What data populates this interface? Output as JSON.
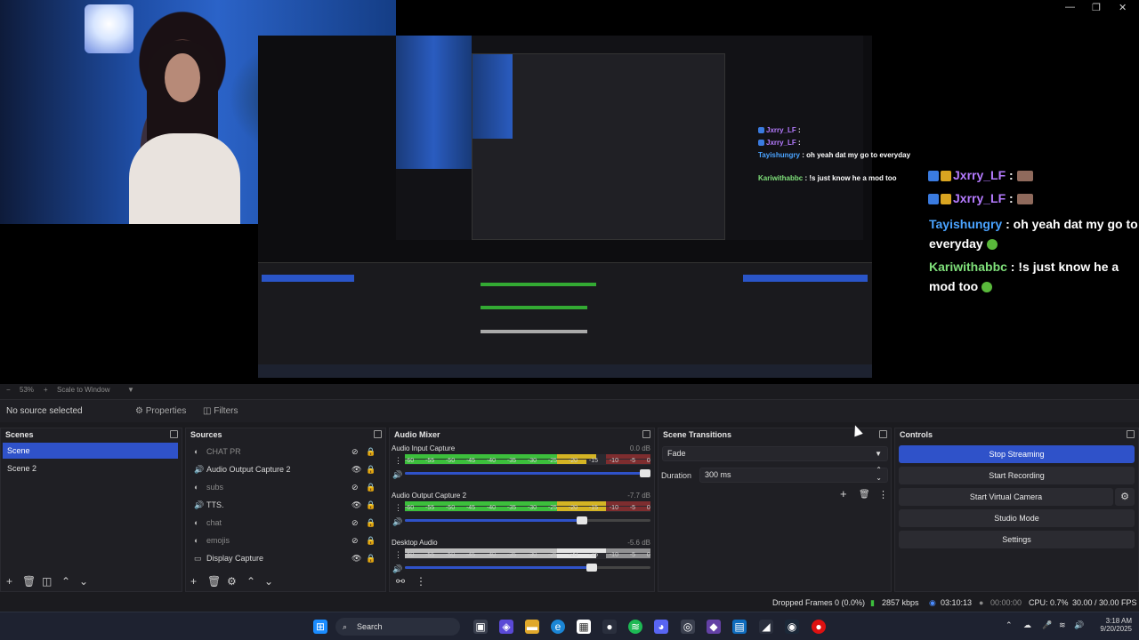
{
  "window_controls": [
    "—",
    "❐",
    "✕"
  ],
  "stream_chat_overlay": [
    {
      "user": "Jxrry_LF",
      "sep": " : ",
      "msg": "",
      "user_color": "#b57bff"
    },
    {
      "user": "Jxrry_LF",
      "sep": " : ",
      "msg": "",
      "user_color": "#b57bff"
    },
    {
      "user": "Tayishungry",
      "sep": " : ",
      "msg": "oh yeah dat my go to everyday",
      "user_color": "#4aa3ff"
    },
    {
      "user": "Kariwithabbc",
      "sep": " : ",
      "msg": "!s just know he a mod too",
      "user_color": "#7fe07a"
    }
  ],
  "zoom_bar": {
    "minus": "−",
    "zoom": "53%",
    "plus": "+",
    "mode": "Scale to Window"
  },
  "toolbar": {
    "no_source": "No source selected",
    "properties": "Properties",
    "filters": "Filters"
  },
  "docks": {
    "scenes": {
      "title": "Scenes",
      "items": [
        "Scene",
        "Scene 2"
      ]
    },
    "sources": {
      "title": "Sources",
      "items": [
        {
          "name": "CHAT PR",
          "icon": "◐",
          "visible": false
        },
        {
          "name": "Audio Output Capture 2",
          "icon": "🔊",
          "visible": true
        },
        {
          "name": "subs",
          "icon": "◐",
          "visible": false
        },
        {
          "name": "TTS.",
          "icon": "🔊",
          "visible": true
        },
        {
          "name": "chat",
          "icon": "◐",
          "visible": false
        },
        {
          "name": "emojis",
          "icon": "◐",
          "visible": false
        },
        {
          "name": "Display Capture",
          "icon": "▭",
          "visible": true
        }
      ]
    },
    "mixer": {
      "title": "Audio Mixer",
      "scale": [
        "-60",
        "-55",
        "-50",
        "-45",
        "-40",
        "-35",
        "-30",
        "-25",
        "-20",
        "-15",
        "-10",
        "-5",
        "0"
      ],
      "channels": [
        {
          "name": "Audio Input Capture",
          "db": "0.0 dB",
          "level": 0.78,
          "volume": 0.98
        },
        {
          "name": "Audio Output Capture 2",
          "db": "-7.7 dB",
          "level": 0.86,
          "volume": 0.72
        },
        {
          "name": "Desktop Audio",
          "db": "-5.6 dB",
          "level": 0.82,
          "volume": 0.76
        }
      ]
    },
    "transitions": {
      "title": "Scene Transitions",
      "selected": "Fade",
      "duration_label": "Duration",
      "duration_value": "300 ms"
    },
    "controls": {
      "title": "Controls",
      "buttons": [
        "Stop Streaming",
        "Start Recording",
        "Start Virtual Camera",
        "Studio Mode",
        "Settings"
      ]
    }
  },
  "status_bar": {
    "dropped": "Dropped Frames 0 (0.0%)",
    "bitrate": "2857 kbps",
    "live": "03:10:13",
    "rec": "00:00:00",
    "cpu": "CPU: 0.7%",
    "fps": "30.00 / 30.00 FPS"
  },
  "taskbar": {
    "search": "Search",
    "time": "3:18 AM",
    "date": "9/20/2025"
  },
  "colors": {
    "accent": "#2f52c9",
    "meter_green": "#3cbf3c",
    "meter_yellow": "#d4b424",
    "meter_red": "#c23030"
  }
}
